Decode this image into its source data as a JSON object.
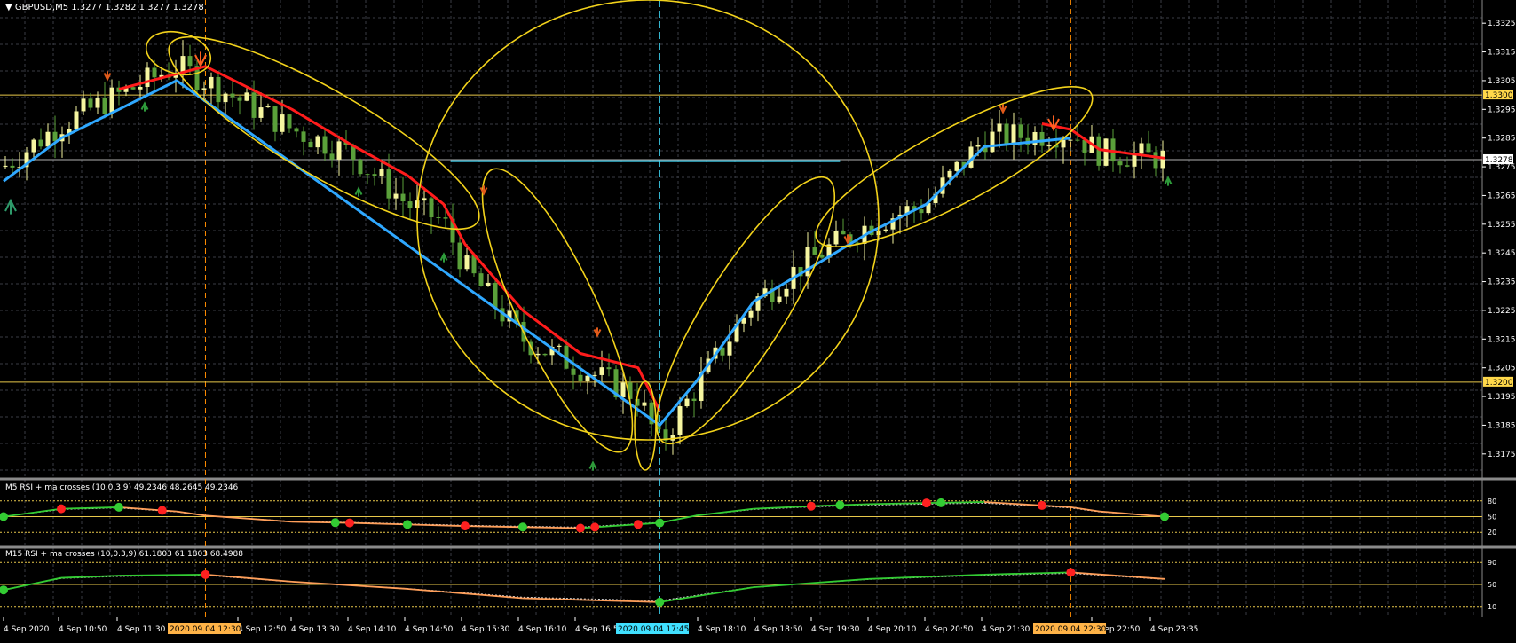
{
  "main_panel": {
    "symbol_label": "GBPUSD,M5",
    "ohlc": "1.3277 1.3282 1.3277 1.3278",
    "price_ticks": [
      "1.3325",
      "1.3315",
      "1.3305",
      "1.3295",
      "1.3285",
      "1.3275",
      "1.3265",
      "1.3255",
      "1.3245",
      "1.3235",
      "1.3225",
      "1.3215",
      "1.3205",
      "1.3195",
      "1.3185",
      "1.3175"
    ],
    "hline_labels": [
      "1.3300",
      "1.3200"
    ],
    "current_price_label": "1.3278"
  },
  "rsi_m5": {
    "title": "M5 RSI + ma crosses (10,0.3,9) 49.2346 48.2645 49.2346",
    "levels": [
      "80",
      "50",
      "20"
    ]
  },
  "rsi_m15": {
    "title": "M15 RSI + ma crosses (10,0.3,9) 61.1803 61.1803 68.4988",
    "levels": [
      "90",
      "50",
      "10"
    ]
  },
  "time_axis": {
    "labels": [
      "4 Sep 2020",
      "4 Sep 10:50",
      "4 Sep 11:30",
      "4 Sep 12:50",
      "4 Sep 13:30",
      "4 Sep 14:10",
      "4 Sep 14:50",
      "4 Sep 15:30",
      "4 Sep 16:10",
      "4 Sep 16:50",
      "4 Sep 18:10",
      "4 Sep 18:50",
      "4 Sep 19:30",
      "4 Sep 20:10",
      "4 Sep 20:50",
      "4 Sep 21:30",
      "4 Sep 22:50",
      "4 Sep 23:35"
    ],
    "highlights": [
      "2020.09.04 12:30",
      "2020.09.04 17:45",
      "2020.09.04 22:30"
    ]
  },
  "colors": {
    "background": "#000000",
    "grid": "#3a3d45",
    "bull_candle": "#f5f5a0",
    "bear_candle": "#5aa03a",
    "red_line": "#ff1c1c",
    "blue_line": "#2fa8ff",
    "ellipse": "#f2d21b",
    "rsi_up": "#33cc33",
    "rsi_down": "#ff9f5a",
    "dot_green": "#33cc33",
    "dot_red": "#ff2020",
    "cyan": "#40e0ff",
    "orange_vline": "#ff8c00"
  },
  "chart_data": {
    "type": "candlestick",
    "symbol": "GBPUSD",
    "timeframe": "M5",
    "ylim": [
      1.317,
      1.333
    ],
    "horizontal_levels": [
      1.33,
      1.32,
      1.32775
    ],
    "close_path": {
      "x": [
        "4 Sep 10:10",
        "4 Sep 10:50",
        "4 Sep 11:30",
        "4 Sep 12:10",
        "4 Sep 12:30",
        "4 Sep 13:30",
        "4 Sep 14:10",
        "4 Sep 14:50",
        "4 Sep 15:15",
        "4 Sep 15:30",
        "4 Sep 16:10",
        "4 Sep 16:50",
        "4 Sep 17:30",
        "4 Sep 17:45",
        "4 Sep 18:10",
        "4 Sep 18:50",
        "4 Sep 19:30",
        "4 Sep 20:10",
        "4 Sep 20:50",
        "4 Sep 21:30",
        "4 Sep 22:30",
        "4 Sep 22:50",
        "4 Sep 23:35"
      ],
      "y": [
        1.3275,
        1.329,
        1.33,
        1.331,
        1.3305,
        1.3288,
        1.328,
        1.3262,
        1.3256,
        1.324,
        1.3215,
        1.3205,
        1.3195,
        1.3178,
        1.3198,
        1.3228,
        1.3243,
        1.3255,
        1.3262,
        1.3285,
        1.3287,
        1.328,
        1.3278
      ]
    },
    "red_signal_line": {
      "x": [
        "4 Sep 11:30",
        "4 Sep 12:30",
        "4 Sep 13:30",
        "4 Sep 14:10",
        "4 Sep 14:50",
        "4 Sep 15:15",
        "4 Sep 15:30",
        "4 Sep 16:10",
        "4 Sep 16:50",
        "4 Sep 17:30",
        "4 Sep 17:45"
      ],
      "y": [
        1.3302,
        1.331,
        1.3295,
        1.3283,
        1.3272,
        1.3262,
        1.3248,
        1.3225,
        1.321,
        1.3205,
        1.319
      ]
    },
    "blue_signal_line": {
      "x": [
        "4 Sep 10:10",
        "4 Sep 10:50",
        "4 Sep 11:30",
        "4 Sep 12:10",
        "4 Sep 17:45",
        "4 Sep 18:10",
        "4 Sep 18:50",
        "4 Sep 19:30",
        "4 Sep 20:10",
        "4 Sep 20:50",
        "4 Sep 21:30",
        "4 Sep 22:30"
      ],
      "y": [
        1.327,
        1.3285,
        1.3295,
        1.3305,
        1.3185,
        1.32,
        1.3228,
        1.324,
        1.3252,
        1.3262,
        1.3282,
        1.3285
      ]
    },
    "tail_red_line": {
      "x": [
        "4 Sep 22:10",
        "4 Sep 22:30",
        "4 Sep 22:50",
        "4 Sep 23:35"
      ],
      "y": [
        1.329,
        1.3288,
        1.3281,
        1.3278
      ]
    },
    "rsi_m5": {
      "ylim": [
        0,
        100
      ],
      "levels": [
        80,
        50,
        20
      ],
      "x": [
        "4 Sep 10:10",
        "4 Sep 10:50",
        "4 Sep 11:30",
        "4 Sep 12:10",
        "4 Sep 12:30",
        "4 Sep 13:30",
        "4 Sep 14:10",
        "4 Sep 14:50",
        "4 Sep 15:30",
        "4 Sep 16:10",
        "4 Sep 16:50",
        "4 Sep 17:45",
        "4 Sep 18:10",
        "4 Sep 18:50",
        "4 Sep 19:30",
        "4 Sep 20:10",
        "4 Sep 20:50",
        "4 Sep 21:30",
        "4 Sep 22:30",
        "4 Sep 22:50",
        "4 Sep 23:35"
      ],
      "values": [
        50,
        65,
        68,
        60,
        52,
        40,
        38,
        35,
        32,
        30,
        28,
        38,
        52,
        65,
        70,
        74,
        76,
        78,
        68,
        60,
        50
      ],
      "cross_dots_green_x": [
        "4 Sep 10:10",
        "4 Sep 11:30",
        "4 Sep 14:00",
        "4 Sep 14:50",
        "4 Sep 16:10",
        "4 Sep 17:45",
        "4 Sep 19:50",
        "4 Sep 21:00",
        "4 Sep 23:35"
      ],
      "cross_dots_red_x": [
        "4 Sep 10:50",
        "4 Sep 12:00",
        "4 Sep 14:10",
        "4 Sep 15:30",
        "4 Sep 16:50",
        "4 Sep 17:00",
        "4 Sep 17:30",
        "4 Sep 19:30",
        "4 Sep 20:50",
        "4 Sep 22:10"
      ]
    },
    "rsi_m15": {
      "ylim": [
        0,
        100
      ],
      "levels": [
        90,
        50,
        10
      ],
      "x": [
        "4 Sep 10:10",
        "4 Sep 10:50",
        "4 Sep 11:30",
        "4 Sep 12:30",
        "4 Sep 13:30",
        "4 Sep 14:50",
        "4 Sep 16:10",
        "4 Sep 17:45",
        "4 Sep 18:50",
        "4 Sep 20:10",
        "4 Sep 21:30",
        "4 Sep 22:30",
        "4 Sep 23:35"
      ],
      "values": [
        40,
        62,
        66,
        68,
        55,
        42,
        25,
        18,
        45,
        60,
        68,
        72,
        60
      ],
      "cross_dots_green_x": [
        "4 Sep 10:10",
        "4 Sep 17:45"
      ],
      "cross_dots_red_x": [
        "4 Sep 12:30",
        "4 Sep 22:30"
      ]
    }
  }
}
